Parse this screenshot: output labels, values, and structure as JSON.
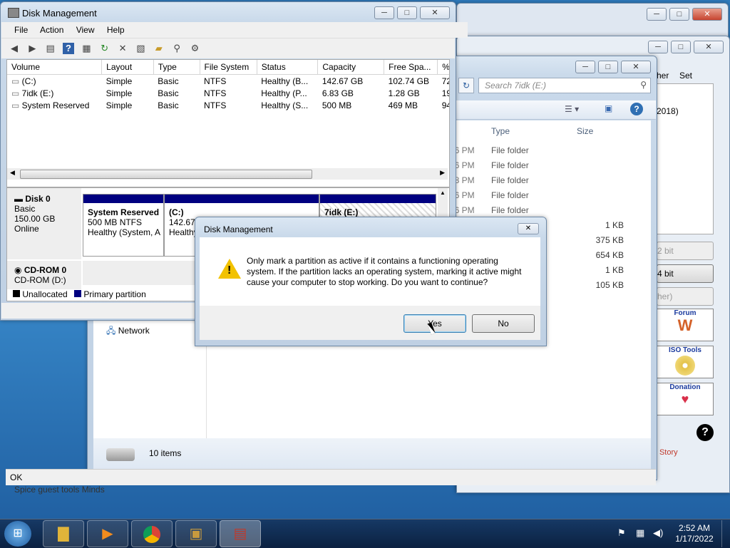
{
  "disk_mgmt": {
    "title": "Disk Management",
    "menu": [
      "File",
      "Action",
      "View",
      "Help"
    ],
    "columns": [
      "Volume",
      "Layout",
      "Type",
      "File System",
      "Status",
      "Capacity",
      "Free Spa...",
      "% F"
    ],
    "rows": [
      [
        "(C:)",
        "Simple",
        "Basic",
        "NTFS",
        "Healthy (B...",
        "142.67 GB",
        "102.74 GB",
        "72"
      ],
      [
        "7idk (E:)",
        "Simple",
        "Basic",
        "NTFS",
        "Healthy (P...",
        "6.83 GB",
        "1.28 GB",
        "19"
      ],
      [
        "System Reserved",
        "Simple",
        "Basic",
        "NTFS",
        "Healthy (S...",
        "500 MB",
        "469 MB",
        "94"
      ]
    ],
    "disk0": {
      "name": "Disk 0",
      "type": "Basic",
      "size": "150.00 GB",
      "state": "Online"
    },
    "partitions": [
      {
        "name": "System Reserved",
        "size": "500 MB NTFS",
        "status": "Healthy (System, A"
      },
      {
        "name": "(C:)",
        "size": "142.67",
        "status": "Healthy"
      },
      {
        "name": "7idk  (E:)",
        "size": "",
        "status": ""
      }
    ],
    "cdrom": {
      "name": "CD-ROM 0",
      "drive": "CD-ROM (D:)"
    },
    "legend": [
      "Unallocated",
      "Primary partition"
    ],
    "status_text": "OK"
  },
  "explorer": {
    "search_placeholder": "Search 7idk (E:)",
    "col_type": "Type",
    "col_size": "Size",
    "rows": [
      {
        "date": "46 PM",
        "type": "File folder",
        "size": ""
      },
      {
        "date": "46 PM",
        "type": "File folder",
        "size": ""
      },
      {
        "date": "48 PM",
        "type": "File folder",
        "size": ""
      },
      {
        "date": "46 PM",
        "type": "File folder",
        "size": ""
      },
      {
        "date": "46 PM",
        "type": "File folder",
        "size": ""
      },
      {
        "date": "",
        "type": "tion",
        "size": "1 KB"
      },
      {
        "date": "",
        "type": "",
        "size": "375 KB"
      },
      {
        "date": "",
        "type": "",
        "size": "654 KB"
      },
      {
        "date": "",
        "type": "t",
        "size": "1 KB"
      },
      {
        "date": "",
        "type": "",
        "size": "105 KB"
      }
    ],
    "nav_network": "Network",
    "items_count": "10 items"
  },
  "right_app": {
    "col1": "her",
    "col2": "Set",
    "year": "2018)",
    "btn_2bit": "2 bit",
    "btn_4bit": "4 bit",
    "btn_her": "her)",
    "forum": "Forum",
    "iso_tools": "ISO Tools",
    "donation": "Donation",
    "story": "ll Story"
  },
  "dialog": {
    "title": "Disk Management",
    "message": "Only mark a partition as active if it contains a functioning operating system. If the partition lacks an operating system, marking it active might cause your computer to stop working. Do you want to continue?",
    "yes": "Yes",
    "no": "No"
  },
  "behind_text": "Spice guest tools Minds",
  "taskbar": {
    "time": "2:52 AM",
    "date": "1/17/2022"
  },
  "colors": {
    "primary_partition": "#000080",
    "unallocated": "#000000",
    "accent": "#2f6fb3"
  }
}
